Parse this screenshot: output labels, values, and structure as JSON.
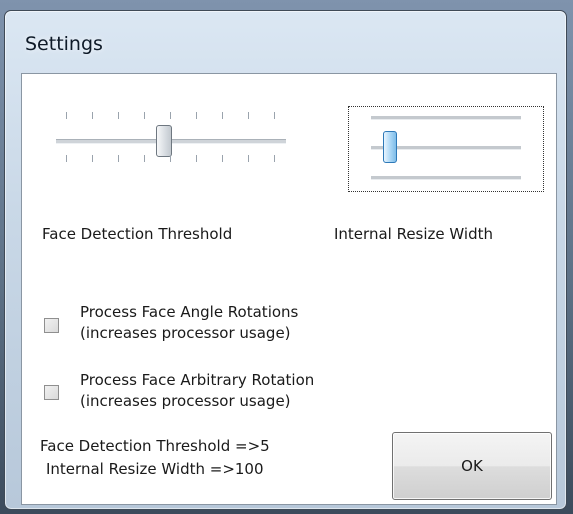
{
  "window": {
    "title": "Settings"
  },
  "sliders": {
    "face_detection": {
      "label": "Face Detection Threshold",
      "value": 5
    },
    "resize_width": {
      "label": "Internal Resize Width",
      "value": 100
    }
  },
  "checkboxes": [
    {
      "line1": "Process Face Angle Rotations",
      "line2": "(increases processor usage)",
      "checked": false
    },
    {
      "line1": "Process Face Arbitrary Rotation",
      "line2": "(increases processor usage)",
      "checked": false
    }
  ],
  "status": {
    "threshold_text": "Face Detection Threshold =>5",
    "resize_text": "Internal Resize Width =>100"
  },
  "buttons": {
    "ok_label": "OK"
  }
}
